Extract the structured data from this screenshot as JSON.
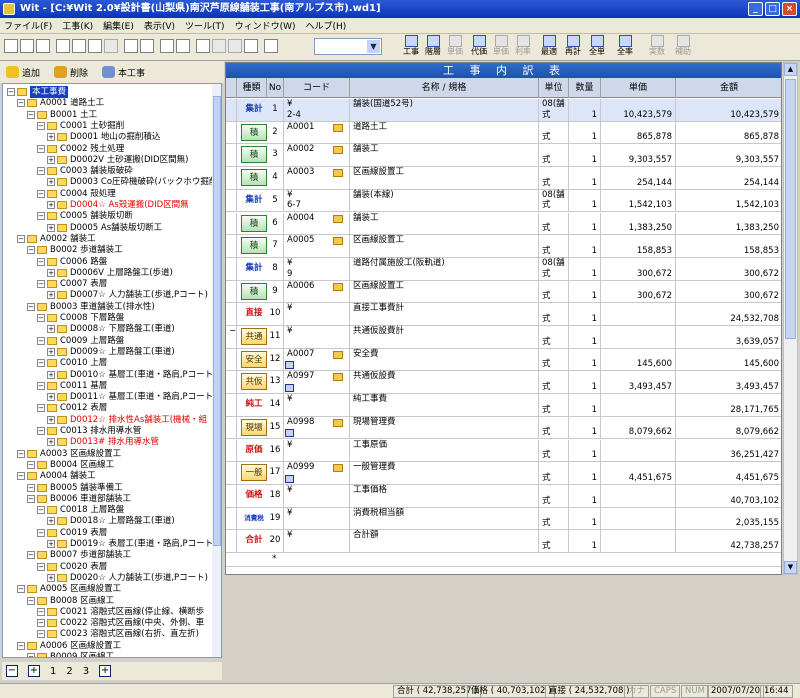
{
  "window": {
    "title": "Wit - [C:¥Wit 2.0¥設計書(山梨県)南沢芦原線舗装工事(南アルプス市).wd1]"
  },
  "menu": [
    "ファイル(F)",
    "工事(K)",
    "編集(E)",
    "表示(V)",
    "ツール(T)",
    "ウィンドウ(W)",
    "ヘルプ(H)"
  ],
  "toolbar": {
    "buttons": [
      {
        "label": "工事",
        "icon": "grid-icon"
      },
      {
        "label": "階層",
        "icon": "grid-icon"
      },
      {
        "label": "単価",
        "icon": "grid-icon",
        "disabled": true
      },
      {
        "label": "代価",
        "icon": "grid-icon"
      },
      {
        "label": "単価",
        "icon": "grid-icon",
        "disabled": true
      },
      {
        "label": "利率",
        "icon": "grid-icon",
        "disabled": true
      },
      {
        "label": "最適",
        "icon": "sort-icon"
      },
      {
        "label": "再計",
        "icon": "recalc-icon"
      },
      {
        "label": "全単",
        "icon": "unit-icon"
      },
      {
        "label": "全率",
        "icon": "percent-icon"
      },
      {
        "label": "実数",
        "icon": "fx-icon",
        "disabled": true
      },
      {
        "label": "補助",
        "icon": "aux-icon",
        "disabled": true
      }
    ],
    "dropdown_value": ""
  },
  "left_toolbar": {
    "add": "追加",
    "delete": "削除",
    "main": "本工事"
  },
  "tree": [
    {
      "d": 0,
      "text": "本工事費",
      "sel": true
    },
    {
      "d": 1,
      "text": "A0001 道路土工"
    },
    {
      "d": 2,
      "text": "B0001 土工"
    },
    {
      "d": 3,
      "text": "C0001 土砂掘削"
    },
    {
      "d": 4,
      "text": "D0001 地山の掘削積込"
    },
    {
      "d": 3,
      "text": "C0002 残土処理"
    },
    {
      "d": 4,
      "text": "D0002V 土砂運搬(DID区間無)"
    },
    {
      "d": 3,
      "text": "C0003 舗装版破砕"
    },
    {
      "d": 4,
      "text": "D0003 Co圧砕機破砕(バックホウ掘削積"
    },
    {
      "d": 3,
      "text": "C0004 殻処理"
    },
    {
      "d": 4,
      "text": "D0004☆ As殻運搬(DID区間無",
      "red": true
    },
    {
      "d": 3,
      "text": "C0005 舗装版切断"
    },
    {
      "d": 4,
      "text": "D0005 As舗装版切断工"
    },
    {
      "d": 1,
      "text": "A0002 舗装工"
    },
    {
      "d": 2,
      "text": "B0002 歩道舗装工"
    },
    {
      "d": 3,
      "text": "C0006 路盤"
    },
    {
      "d": 4,
      "text": "D0006V 上層路盤工(歩道)"
    },
    {
      "d": 3,
      "text": "C0007 表層"
    },
    {
      "d": 4,
      "text": "D0007☆ 人力舗装工(歩道,Pコート)"
    },
    {
      "d": 2,
      "text": "B0003 車道舗装工(排水性)"
    },
    {
      "d": 3,
      "text": "C0008 下層路盤"
    },
    {
      "d": 4,
      "text": "D0008☆ 下層路盤工(車道)"
    },
    {
      "d": 3,
      "text": "C0009 上層路盤"
    },
    {
      "d": 4,
      "text": "D0009☆ 上層路盤工(車道)"
    },
    {
      "d": 3,
      "text": "C0010 上層"
    },
    {
      "d": 4,
      "text": "D0010☆ 基層工(車道・路肩,Pコート"
    },
    {
      "d": 3,
      "text": "C0011 基層"
    },
    {
      "d": 4,
      "text": "D0011☆ 基層工(車道・路肩,Pコート"
    },
    {
      "d": 3,
      "text": "C0012 表層"
    },
    {
      "d": 4,
      "text": "D0012☆ 排水性As舗装工(機械・組",
      "red": true
    },
    {
      "d": 3,
      "text": "C0013 排水用導水管"
    },
    {
      "d": 4,
      "text": "D0013# 排水用導水管",
      "red": true
    },
    {
      "d": 1,
      "text": "A0003 区画線設置工"
    },
    {
      "d": 2,
      "text": "B0004 区画線工"
    },
    {
      "d": 1,
      "text": "A0004 舗装工"
    },
    {
      "d": 2,
      "text": "B0005 舗装準備工"
    },
    {
      "d": 2,
      "text": "B0006 車道部舗装工"
    },
    {
      "d": 3,
      "text": "C0018 上層路盤"
    },
    {
      "d": 4,
      "text": "D0018☆ 上層路盤工(車道)"
    },
    {
      "d": 3,
      "text": "C0019 表層"
    },
    {
      "d": 4,
      "text": "D0019☆ 表層工(車道・路肩,Pコート"
    },
    {
      "d": 2,
      "text": "B0007 歩道部舗装工"
    },
    {
      "d": 3,
      "text": "C0020 表層"
    },
    {
      "d": 4,
      "text": "D0020☆ 人力舗装工(歩道,Pコート)"
    },
    {
      "d": 1,
      "text": "A0005 区画線設置工"
    },
    {
      "d": 2,
      "text": "B0008 区画線工"
    },
    {
      "d": 3,
      "text": "C0021 溶融式区画線(停止線、横断歩"
    },
    {
      "d": 3,
      "text": "C0022 溶融式区画線(中央、外側、車"
    },
    {
      "d": 3,
      "text": "C0023 溶融式区画線(右折、直左折)"
    },
    {
      "d": 1,
      "text": "A0006 区画線設置工"
    },
    {
      "d": 2,
      "text": "B0009 区画線工"
    }
  ],
  "tree_pages": [
    "1",
    "2",
    "3"
  ],
  "grid": {
    "title": "工 事 内 訳 表",
    "headers": [
      "",
      "種類",
      "No",
      "コード",
      "名称 / 規格",
      "単位",
      "数量",
      "単価",
      "金額"
    ],
    "rows": [
      {
        "kind": "集計",
        "kc": "blue",
        "no": "1",
        "code1": "¥",
        "code2": "2-4",
        "name1": "舗装(国道52号)",
        "name2": "",
        "unit1": "08(舗",
        "unit2": "式",
        "qty": "1",
        "price": "10,423,579",
        "amount": "10,423,579",
        "hl": true
      },
      {
        "kind": "積",
        "kc": "green",
        "no": "2",
        "code1": "A0001",
        "code2": "",
        "name1": "道路土工",
        "name2": "",
        "unit1": "",
        "unit2": "式",
        "qty": "1",
        "price": "865,878",
        "amount": "865,878",
        "folder": true
      },
      {
        "kind": "積",
        "kc": "green",
        "no": "3",
        "code1": "A0002",
        "code2": "",
        "name1": "舗装工",
        "name2": "",
        "unit1": "",
        "unit2": "式",
        "qty": "1",
        "price": "9,303,557",
        "amount": "9,303,557",
        "folder": true
      },
      {
        "kind": "積",
        "kc": "green",
        "no": "4",
        "code1": "A0003",
        "code2": "",
        "name1": "区画線設置工",
        "name2": "",
        "unit1": "",
        "unit2": "式",
        "qty": "1",
        "price": "254,144",
        "amount": "254,144",
        "folder": true
      },
      {
        "kind": "集計",
        "kc": "blue",
        "no": "5",
        "code1": "¥",
        "code2": "6-7",
        "name1": "舗装(本線)",
        "name2": "",
        "unit1": "08(舗",
        "unit2": "式",
        "qty": "1",
        "price": "1,542,103",
        "amount": "1,542,103"
      },
      {
        "kind": "積",
        "kc": "green",
        "no": "6",
        "code1": "A0004",
        "code2": "",
        "name1": "舗装工",
        "name2": "",
        "unit1": "",
        "unit2": "式",
        "qty": "1",
        "price": "1,383,250",
        "amount": "1,383,250",
        "folder": true
      },
      {
        "kind": "積",
        "kc": "green",
        "no": "7",
        "code1": "A0005",
        "code2": "",
        "name1": "区画線設置工",
        "name2": "",
        "unit1": "",
        "unit2": "式",
        "qty": "1",
        "price": "158,853",
        "amount": "158,853",
        "folder": true
      },
      {
        "kind": "集計",
        "kc": "blue",
        "no": "8",
        "code1": "¥",
        "code2": "9",
        "name1": "道路付属施設工(阪軌道)",
        "name2": "",
        "unit1": "08(舗",
        "unit2": "式",
        "qty": "1",
        "price": "300,672",
        "amount": "300,672"
      },
      {
        "kind": "積",
        "kc": "green",
        "no": "9",
        "code1": "A0006",
        "code2": "",
        "name1": "区画線設置工",
        "name2": "",
        "unit1": "",
        "unit2": "式",
        "qty": "1",
        "price": "300,672",
        "amount": "300,672",
        "folder": true
      },
      {
        "kind": "直接",
        "kc": "red",
        "no": "10",
        "code1": "¥",
        "code2": "",
        "name1": "直接工事費計",
        "name2": "",
        "unit1": "",
        "unit2": "式",
        "qty": "1",
        "price": "",
        "amount": "24,532,708"
      },
      {
        "kind": "共通",
        "kc": "yellow",
        "no": "11",
        "code1": "¥",
        "code2": "",
        "name1": "共通仮設費計",
        "name2": "",
        "unit1": "",
        "unit2": "式",
        "qty": "1",
        "price": "",
        "amount": "3,639,057",
        "mark": "−"
      },
      {
        "kind": "安全",
        "kc": "yellow",
        "no": "12",
        "code1": "A0007",
        "code2": "",
        "name1": "安全費",
        "name2": "",
        "unit1": "",
        "unit2": "式",
        "qty": "1",
        "price": "145,600",
        "amount": "145,600",
        "folder": true,
        "gicon": true
      },
      {
        "kind": "共仮",
        "kc": "yellow",
        "no": "13",
        "code1": "A0997",
        "code2": "",
        "name1": "共通仮設費",
        "name2": "",
        "unit1": "",
        "unit2": "式",
        "qty": "1",
        "price": "3,493,457",
        "amount": "3,493,457",
        "folder": true,
        "gicon": true
      },
      {
        "kind": "純工",
        "kc": "red",
        "no": "14",
        "code1": "¥",
        "code2": "",
        "name1": "純工事費",
        "name2": "",
        "unit1": "",
        "unit2": "式",
        "qty": "1",
        "price": "",
        "amount": "28,171,765"
      },
      {
        "kind": "現場",
        "kc": "yellow",
        "no": "15",
        "code1": "A0998",
        "code2": "",
        "name1": "現場管理費",
        "name2": "",
        "unit1": "",
        "unit2": "式",
        "qty": "1",
        "price": "8,079,662",
        "amount": "8,079,662",
        "folder": true,
        "gicon": true
      },
      {
        "kind": "原価",
        "kc": "red",
        "no": "16",
        "code1": "¥",
        "code2": "",
        "name1": "工事原価",
        "name2": "",
        "unit1": "",
        "unit2": "式",
        "qty": "1",
        "price": "",
        "amount": "36,251,427"
      },
      {
        "kind": "一般",
        "kc": "yellow",
        "no": "17",
        "code1": "A0999",
        "code2": "",
        "name1": "一般管理費",
        "name2": "",
        "unit1": "",
        "unit2": "式",
        "qty": "1",
        "price": "4,451,675",
        "amount": "4,451,675",
        "folder": true,
        "gicon": true
      },
      {
        "kind": "価格",
        "kc": "red",
        "no": "18",
        "code1": "¥",
        "code2": "",
        "name1": "工事価格",
        "name2": "",
        "unit1": "",
        "unit2": "式",
        "qty": "1",
        "price": "",
        "amount": "40,703,102"
      },
      {
        "kind": "消費税",
        "kc": "small",
        "no": "19",
        "code1": "¥",
        "code2": "",
        "name1": "消費税相当額",
        "name2": "",
        "unit1": "",
        "unit2": "式",
        "qty": "1",
        "price": "",
        "amount": "2,035,155"
      },
      {
        "kind": "合計",
        "kc": "red",
        "no": "20",
        "code1": "¥",
        "code2": "",
        "name1": "合計額",
        "name2": "",
        "unit1": "",
        "unit2": "式",
        "qty": "1",
        "price": "",
        "amount": "42,738,257"
      }
    ],
    "new_row_marker": "*"
  },
  "status": {
    "total": "合計 ( 42,738,257 )",
    "price": "価格 ( 40,703,102 )",
    "direct": "直接 ( 24,532,708 )",
    "kana": "カナ",
    "caps": "CAPS",
    "num": "NUM",
    "date": "2007/07/20",
    "time": "16:44"
  }
}
